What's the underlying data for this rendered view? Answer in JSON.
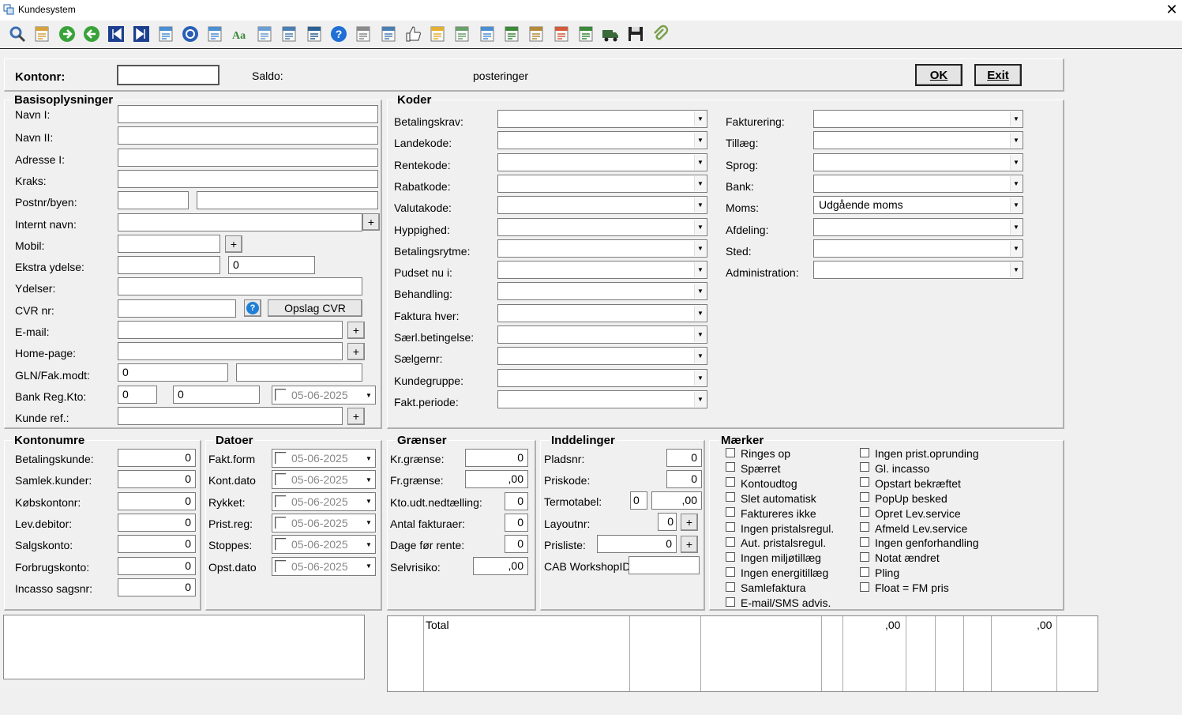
{
  "window": {
    "title": "Kundesystem",
    "close": "✕"
  },
  "toolbar": {
    "icons": [
      "search-icon",
      "edit-note-icon",
      "forward-icon",
      "back-icon",
      "first-record-icon",
      "last-record-icon",
      "bin-icon",
      "target-icon",
      "calendar-icon",
      "font-icon",
      "copy-icon",
      "transfer-icon",
      "download-icon",
      "help-icon",
      "document-icon",
      "print-icon",
      "thumbs-up-icon",
      "note-icon",
      "sheet-icon",
      "chart-icon",
      "report-icon",
      "edit-list-icon",
      "window-icon",
      "chart-edit-icon",
      "truck-icon",
      "save-icon",
      "attach-icon"
    ]
  },
  "top": {
    "kontonr_label": "Kontonr:",
    "kontonr_value": "",
    "saldo_label": "Saldo:",
    "posteringer_label": "posteringer",
    "ok_label": "OK",
    "exit_label": "Exit"
  },
  "basis": {
    "title": "Basisoplysninger",
    "navn1": "Navn I:",
    "navn2": "Navn II:",
    "adresse": "Adresse I:",
    "kraks": "Kraks:",
    "postnr": "Postnr/byen:",
    "internt": "Internt navn:",
    "mobil": "Mobil:",
    "ekstra": "Ekstra ydelse:",
    "ekstra_value": "0",
    "ydelser": "Ydelser:",
    "cvr": "CVR nr:",
    "opslag": "Opslag CVR",
    "email": "E-mail:",
    "homepage": "Home-page:",
    "gln": "GLN/Fak.modt:",
    "gln_value": "0",
    "bankreg": "Bank Reg.Kto:",
    "bank_reg_value": "0",
    "bank_kto_value": "0",
    "bank_date": "05-06-2025",
    "kunderef": "Kunde ref.:",
    "plus": "+",
    "help": "?"
  },
  "koder": {
    "title": "Koder",
    "left": [
      "Betalingskrav:",
      "Landekode:",
      "Rentekode:",
      "Rabatkode:",
      "Valutakode:",
      "Hyppighed:",
      "Betalingsrytme:",
      "Pudset nu i:",
      "Behandling:",
      "Faktura hver:",
      "Særl.betingelse:",
      "Sælgernr:",
      "Kundegruppe:",
      "Fakt.periode:"
    ],
    "right": [
      "Fakturering:",
      "Tillæg:",
      "Sprog:",
      "Bank:",
      "Moms:",
      "Afdeling:",
      "Sted:",
      "Administration:"
    ],
    "right_values": [
      "",
      "",
      "",
      "",
      "Udgående moms",
      "",
      "",
      ""
    ]
  },
  "kontonumre": {
    "title": "Kontonumre",
    "labels": [
      "Betalingskunde:",
      "Samlek.kunder:",
      "Købskontonr:",
      "Lev.debitor:",
      "Salgskonto:",
      "Forbrugskonto:",
      "Incasso sagsnr:"
    ],
    "values": [
      "0",
      "0",
      "0",
      "0",
      "0",
      "0",
      "0"
    ]
  },
  "datoer": {
    "title": "Datoer",
    "labels": [
      "Fakt.form",
      "Kont.dato",
      "Rykket:",
      "Prist.reg:",
      "Stoppes:",
      "Opst.dato"
    ],
    "values": [
      "05-06-2025",
      "05-06-2025",
      "05-06-2025",
      "05-06-2025",
      "05-06-2025",
      "05-06-2025"
    ]
  },
  "graenser": {
    "title": "Grænser",
    "labels": [
      "Kr.grænse:",
      "Fr.grænse:",
      "Kto.udt.nedtælling:",
      "Antal fakturaer:",
      "Dage før rente:",
      "Selvrisiko:"
    ],
    "values": [
      "0",
      ",00",
      "0",
      "0",
      "0",
      ",00"
    ]
  },
  "inddelinger": {
    "title": "Inddelinger",
    "pladsnr": "Pladsnr:",
    "pladsnr_value": "0",
    "priskode": "Priskode:",
    "priskode_value": "0",
    "termotabel": "Termotabel:",
    "termo_a": "0",
    "termo_b": ",00",
    "layoutnr": "Layoutnr:",
    "layout_value": "0",
    "prisliste": "Prisliste:",
    "prisliste_value": "0",
    "cab": "CAB WorkshopID"
  },
  "maerker": {
    "title": "Mærker",
    "col1": [
      "Ringes op",
      "Spærret",
      "Kontoudtog",
      "Slet automatisk",
      "Faktureres ikke",
      "Ingen pristalsregul.",
      "Aut. pristalsregul.",
      "Ingen miljøtillæg",
      "Ingen energitillæg",
      "Samlefaktura",
      "E-mail/SMS advis."
    ],
    "col2": [
      "Ingen prist.oprunding",
      "Gl. incasso",
      "Opstart bekræftet",
      "PopUp besked",
      "Opret Lev.service",
      "Afmeld Lev.service",
      "Ingen genforhandling",
      "Notat ændret",
      "Pling",
      "Float = FM pris"
    ]
  },
  "totals": {
    "label": "Total",
    "v1": ",00",
    "v2": ",00"
  }
}
